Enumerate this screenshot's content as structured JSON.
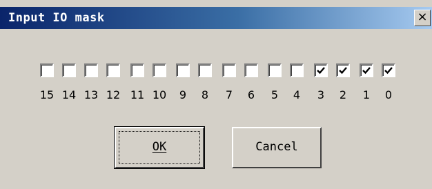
{
  "window": {
    "title": "Input IO mask",
    "close_label": "×"
  },
  "bits": [
    {
      "label": "15",
      "checked": false
    },
    {
      "label": "14",
      "checked": false
    },
    {
      "label": "13",
      "checked": false
    },
    {
      "label": "12",
      "checked": false
    },
    {
      "label": "11",
      "checked": false
    },
    {
      "label": "10",
      "checked": false
    },
    {
      "label": "9",
      "checked": false
    },
    {
      "label": "8",
      "checked": false
    },
    {
      "label": "7",
      "checked": false
    },
    {
      "label": "6",
      "checked": false
    },
    {
      "label": "5",
      "checked": false
    },
    {
      "label": "4",
      "checked": false
    },
    {
      "label": "3",
      "checked": true
    },
    {
      "label": "2",
      "checked": true
    },
    {
      "label": "1",
      "checked": true
    },
    {
      "label": "0",
      "checked": true
    }
  ],
  "buttons": {
    "ok_label": "OK",
    "cancel_label": "Cancel"
  }
}
